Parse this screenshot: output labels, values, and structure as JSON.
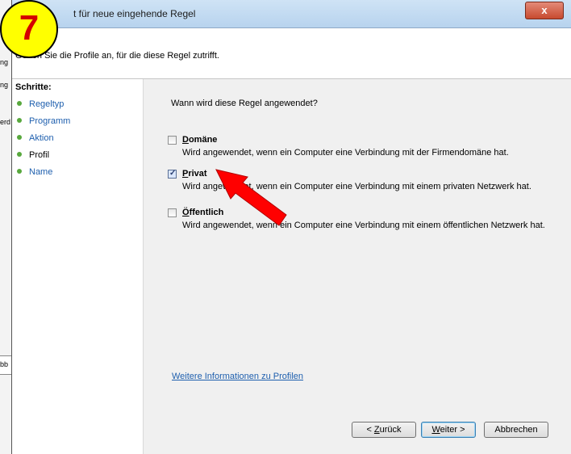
{
  "window": {
    "title": "Assistent für neue eingehende Regel",
    "title_visible": "t für neue eingehende Regel",
    "close_symbol": "x"
  },
  "header": {
    "description": "Geben Sie die Profile an, für die diese Regel zutrifft."
  },
  "sidebar": {
    "heading": "Schritte:",
    "items": [
      {
        "label": "Regeltyp",
        "current": false
      },
      {
        "label": "Programm",
        "current": false
      },
      {
        "label": "Aktion",
        "current": false
      },
      {
        "label": "Profil",
        "current": true
      },
      {
        "label": "Name",
        "current": false
      }
    ]
  },
  "main": {
    "question": "Wann wird diese Regel angewendet?",
    "options": [
      {
        "label_first": "D",
        "label_rest": "omäne",
        "checked": false,
        "description": "Wird angewendet, wenn ein Computer eine Verbindung mit der Firmendomäne hat."
      },
      {
        "label_first": "P",
        "label_rest": "rivat",
        "checked": true,
        "description": "Wird angewendet, wenn ein Computer eine Verbindung mit einem privaten Netzwerk hat."
      },
      {
        "label_first": "Ö",
        "label_rest": "ffentlich",
        "checked": false,
        "description": "Wird angewendet, wenn ein Computer eine Verbindung mit einem öffentlichen Netzwerk hat."
      }
    ],
    "info_link": "Weitere Informationen zu Profilen"
  },
  "buttons": {
    "back": {
      "prefix": "< ",
      "accel": "Z",
      "rest": "urück"
    },
    "next": {
      "accel": "W",
      "rest": "eiter >"
    },
    "cancel": "Abbrechen"
  },
  "overlay": {
    "step_number": "7",
    "badge_color": "#ffff00",
    "number_color": "#d40000",
    "arrow_color": "#ff0000"
  },
  "background_window": {
    "fragments": [
      "ng",
      "erd",
      "ng",
      "bb"
    ]
  }
}
